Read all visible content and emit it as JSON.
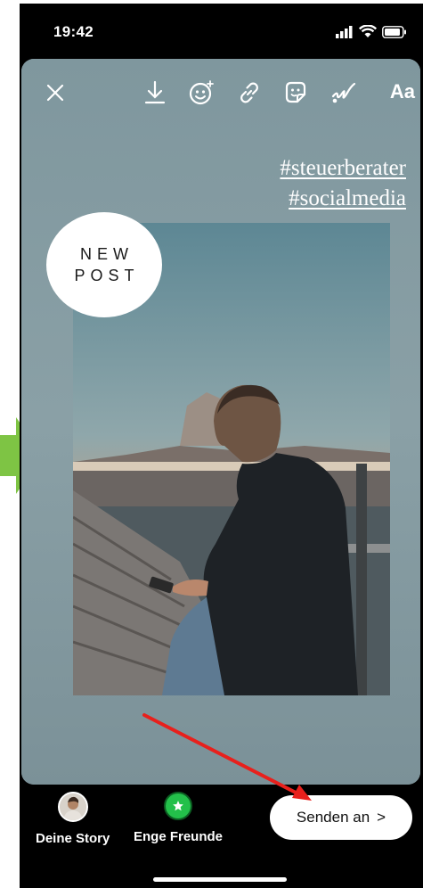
{
  "status_bar": {
    "time": "19:42"
  },
  "toolbar": {
    "icons": [
      "close-icon",
      "download-icon",
      "face-effects-icon",
      "link-icon",
      "sticker-icon",
      "draw-icon"
    ],
    "text_tool_label": "Aa"
  },
  "story": {
    "hashtags": [
      "#steuerberater",
      "#socialmedia"
    ],
    "badge_lines": [
      "NEW",
      "POST"
    ]
  },
  "share": {
    "your_story_label": "Deine Story",
    "close_friends_label": "Enge Freunde",
    "send_label": "Senden an",
    "send_chevron": ">"
  },
  "colors": {
    "canvas": "#859ba2",
    "close_friends": "#23c04a",
    "annotation_arrow": "#e8201c",
    "side_arrow": "#7ec444"
  }
}
